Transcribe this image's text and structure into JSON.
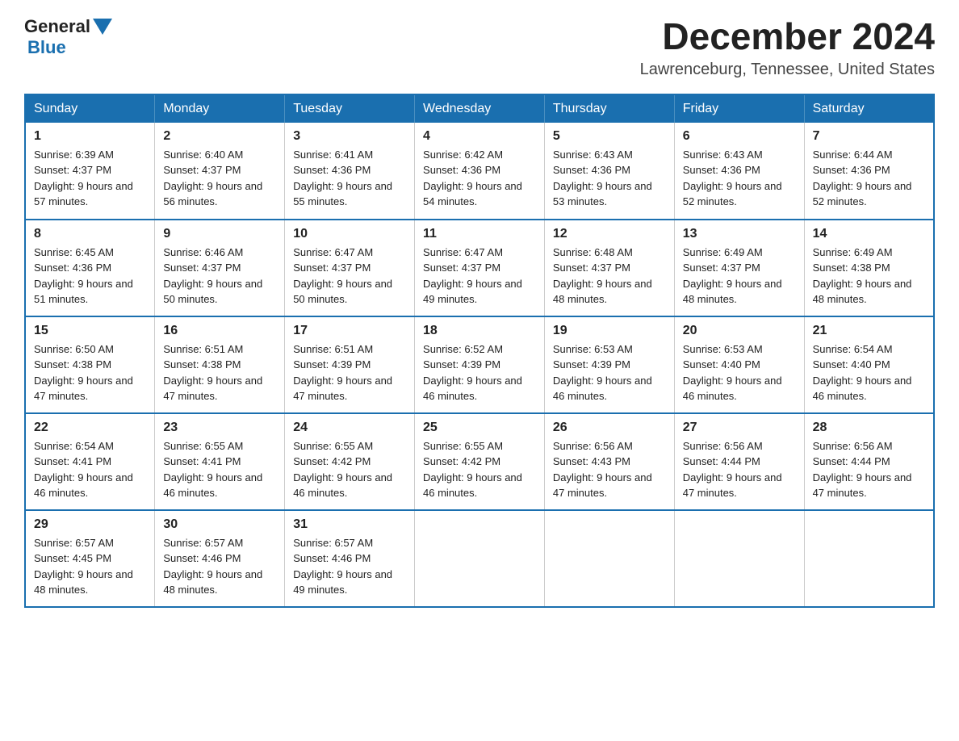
{
  "header": {
    "logo_general": "General",
    "logo_blue": "Blue",
    "month_title": "December 2024",
    "location": "Lawrenceburg, Tennessee, United States"
  },
  "weekdays": [
    "Sunday",
    "Monday",
    "Tuesday",
    "Wednesday",
    "Thursday",
    "Friday",
    "Saturday"
  ],
  "weeks": [
    [
      {
        "day": "1",
        "sunrise": "6:39 AM",
        "sunset": "4:37 PM",
        "daylight": "9 hours and 57 minutes."
      },
      {
        "day": "2",
        "sunrise": "6:40 AM",
        "sunset": "4:37 PM",
        "daylight": "9 hours and 56 minutes."
      },
      {
        "day": "3",
        "sunrise": "6:41 AM",
        "sunset": "4:36 PM",
        "daylight": "9 hours and 55 minutes."
      },
      {
        "day": "4",
        "sunrise": "6:42 AM",
        "sunset": "4:36 PM",
        "daylight": "9 hours and 54 minutes."
      },
      {
        "day": "5",
        "sunrise": "6:43 AM",
        "sunset": "4:36 PM",
        "daylight": "9 hours and 53 minutes."
      },
      {
        "day": "6",
        "sunrise": "6:43 AM",
        "sunset": "4:36 PM",
        "daylight": "9 hours and 52 minutes."
      },
      {
        "day": "7",
        "sunrise": "6:44 AM",
        "sunset": "4:36 PM",
        "daylight": "9 hours and 52 minutes."
      }
    ],
    [
      {
        "day": "8",
        "sunrise": "6:45 AM",
        "sunset": "4:36 PM",
        "daylight": "9 hours and 51 minutes."
      },
      {
        "day": "9",
        "sunrise": "6:46 AM",
        "sunset": "4:37 PM",
        "daylight": "9 hours and 50 minutes."
      },
      {
        "day": "10",
        "sunrise": "6:47 AM",
        "sunset": "4:37 PM",
        "daylight": "9 hours and 50 minutes."
      },
      {
        "day": "11",
        "sunrise": "6:47 AM",
        "sunset": "4:37 PM",
        "daylight": "9 hours and 49 minutes."
      },
      {
        "day": "12",
        "sunrise": "6:48 AM",
        "sunset": "4:37 PM",
        "daylight": "9 hours and 48 minutes."
      },
      {
        "day": "13",
        "sunrise": "6:49 AM",
        "sunset": "4:37 PM",
        "daylight": "9 hours and 48 minutes."
      },
      {
        "day": "14",
        "sunrise": "6:49 AM",
        "sunset": "4:38 PM",
        "daylight": "9 hours and 48 minutes."
      }
    ],
    [
      {
        "day": "15",
        "sunrise": "6:50 AM",
        "sunset": "4:38 PM",
        "daylight": "9 hours and 47 minutes."
      },
      {
        "day": "16",
        "sunrise": "6:51 AM",
        "sunset": "4:38 PM",
        "daylight": "9 hours and 47 minutes."
      },
      {
        "day": "17",
        "sunrise": "6:51 AM",
        "sunset": "4:39 PM",
        "daylight": "9 hours and 47 minutes."
      },
      {
        "day": "18",
        "sunrise": "6:52 AM",
        "sunset": "4:39 PM",
        "daylight": "9 hours and 46 minutes."
      },
      {
        "day": "19",
        "sunrise": "6:53 AM",
        "sunset": "4:39 PM",
        "daylight": "9 hours and 46 minutes."
      },
      {
        "day": "20",
        "sunrise": "6:53 AM",
        "sunset": "4:40 PM",
        "daylight": "9 hours and 46 minutes."
      },
      {
        "day": "21",
        "sunrise": "6:54 AM",
        "sunset": "4:40 PM",
        "daylight": "9 hours and 46 minutes."
      }
    ],
    [
      {
        "day": "22",
        "sunrise": "6:54 AM",
        "sunset": "4:41 PM",
        "daylight": "9 hours and 46 minutes."
      },
      {
        "day": "23",
        "sunrise": "6:55 AM",
        "sunset": "4:41 PM",
        "daylight": "9 hours and 46 minutes."
      },
      {
        "day": "24",
        "sunrise": "6:55 AM",
        "sunset": "4:42 PM",
        "daylight": "9 hours and 46 minutes."
      },
      {
        "day": "25",
        "sunrise": "6:55 AM",
        "sunset": "4:42 PM",
        "daylight": "9 hours and 46 minutes."
      },
      {
        "day": "26",
        "sunrise": "6:56 AM",
        "sunset": "4:43 PM",
        "daylight": "9 hours and 47 minutes."
      },
      {
        "day": "27",
        "sunrise": "6:56 AM",
        "sunset": "4:44 PM",
        "daylight": "9 hours and 47 minutes."
      },
      {
        "day": "28",
        "sunrise": "6:56 AM",
        "sunset": "4:44 PM",
        "daylight": "9 hours and 47 minutes."
      }
    ],
    [
      {
        "day": "29",
        "sunrise": "6:57 AM",
        "sunset": "4:45 PM",
        "daylight": "9 hours and 48 minutes."
      },
      {
        "day": "30",
        "sunrise": "6:57 AM",
        "sunset": "4:46 PM",
        "daylight": "9 hours and 48 minutes."
      },
      {
        "day": "31",
        "sunrise": "6:57 AM",
        "sunset": "4:46 PM",
        "daylight": "9 hours and 49 minutes."
      },
      null,
      null,
      null,
      null
    ]
  ]
}
